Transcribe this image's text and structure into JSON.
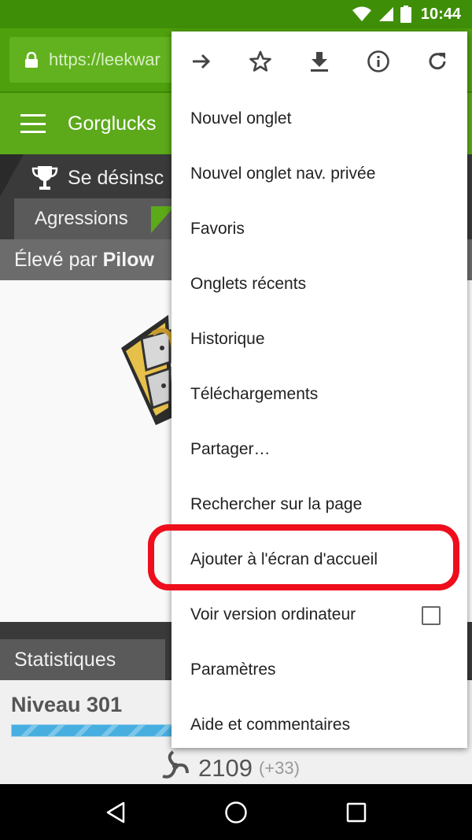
{
  "status_bar": {
    "time": "10:44",
    "icons": [
      "wifi-icon",
      "signal-icon",
      "battery-icon"
    ]
  },
  "browser": {
    "url": "https://leekwar"
  },
  "site": {
    "title": "Gorglucks",
    "unsubscribe": "Se désinsc",
    "tab_aggressions": "Agressions",
    "breeder_prefix": "Élevé par",
    "breeder_name": "Pilow",
    "stats_tab": "Statistiques",
    "level": "Niveau 301",
    "xp_progress": 1.0,
    "talent_value": "2109",
    "talent_delta": "(+33)"
  },
  "menu": {
    "icon_row": [
      "forward-icon",
      "star-icon",
      "download-icon",
      "info-icon",
      "refresh-icon"
    ],
    "items": [
      {
        "label": "Nouvel onglet"
      },
      {
        "label": "Nouvel onglet nav. privée"
      },
      {
        "label": "Favoris"
      },
      {
        "label": "Onglets récents"
      },
      {
        "label": "Historique"
      },
      {
        "label": "Téléchargements"
      },
      {
        "label": "Partager…"
      },
      {
        "label": "Rechercher sur la page"
      },
      {
        "label": "Ajouter à l'écran d'accueil"
      },
      {
        "label": "Voir version ordinateur",
        "checkbox": false
      },
      {
        "label": "Paramètres"
      },
      {
        "label": "Aide et commentaires"
      }
    ]
  },
  "colors": {
    "status_bar": "#3f8e08",
    "toolbar": "#4fa00d",
    "site_header": "#5ca91a",
    "highlight": "#ee0e1c",
    "xp_bar": "#47aee0"
  },
  "nav_bar": [
    "back-icon",
    "home-icon",
    "recents-icon"
  ]
}
